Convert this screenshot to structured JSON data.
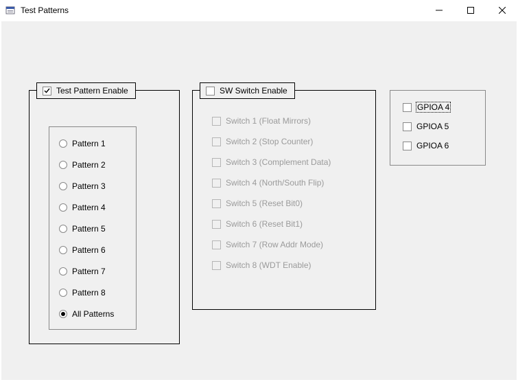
{
  "window": {
    "title": "Test Patterns"
  },
  "group1": {
    "legend": "Test Pattern Enable",
    "legend_checked": true,
    "patterns": [
      {
        "label": "Pattern 1",
        "selected": false
      },
      {
        "label": "Pattern 2",
        "selected": false
      },
      {
        "label": "Pattern 3",
        "selected": false
      },
      {
        "label": "Pattern 4",
        "selected": false
      },
      {
        "label": "Pattern 5",
        "selected": false
      },
      {
        "label": "Pattern 6",
        "selected": false
      },
      {
        "label": "Pattern 7",
        "selected": false
      },
      {
        "label": "Pattern 8",
        "selected": false
      },
      {
        "label": "All Patterns",
        "selected": true
      }
    ]
  },
  "group2": {
    "legend": "SW Switch Enable",
    "legend_checked": false,
    "switches": [
      {
        "label": "Switch 1 (Float Mirrors)"
      },
      {
        "label": "Switch 2 (Stop Counter)"
      },
      {
        "label": "Switch 3 (Complement Data)"
      },
      {
        "label": "Switch 4 (North/South Flip)"
      },
      {
        "label": "Switch 5 (Reset Bit0)"
      },
      {
        "label": "Switch 6 (Reset Bit1)"
      },
      {
        "label": "Switch 7 (Row Addr Mode)"
      },
      {
        "label": "Switch 8 (WDT Enable)"
      }
    ]
  },
  "group3": {
    "items": [
      {
        "label": "GPIOA 4",
        "focused": true
      },
      {
        "label": "GPIOA 5",
        "focused": false
      },
      {
        "label": "GPIOA 6",
        "focused": false
      }
    ]
  }
}
